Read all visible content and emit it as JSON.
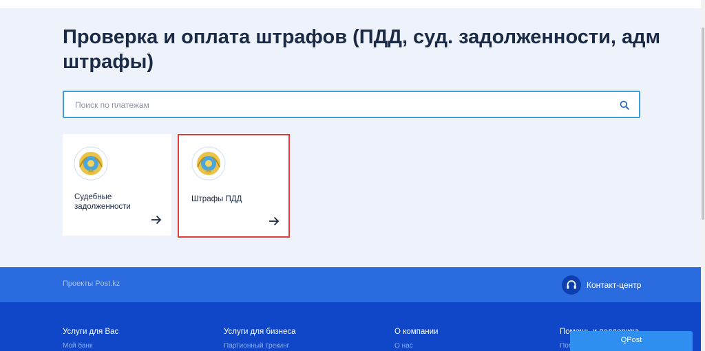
{
  "page": {
    "title": "Проверка и оплата штрафов (ПДД, суд. задолженности, адм штрафы)"
  },
  "search": {
    "placeholder": "Поиск по платежам"
  },
  "cards": [
    {
      "label": "Судебные задолженности",
      "icon": "kazakhstan-emblem-icon",
      "arrow": "arrow-right-icon"
    },
    {
      "label": "Штрафы ПДД",
      "icon": "kazakhstan-emblem-icon",
      "arrow": "arrow-right-icon",
      "highlighted": true
    }
  ],
  "projects_bar": {
    "label": "Проекты Post.kz",
    "contact_label": "Контакт-центр",
    "contact_icon": "headset-icon"
  },
  "footer": {
    "columns": [
      {
        "heading": "Услуги для Вас",
        "first_item": "Мой банк"
      },
      {
        "heading": "Услуги для бизнеса",
        "first_item": "Партионный трекинг"
      },
      {
        "heading": "О компании",
        "first_item": "О нас"
      },
      {
        "heading": "Помощь и поддержка",
        "first_item": "Пом"
      }
    ]
  },
  "qpost": {
    "label": "QPost"
  },
  "colors": {
    "page_bg": "#eef3fb",
    "title": "#1b2a45",
    "search_border": "#3ba0d8",
    "highlight_border": "#e23d3d",
    "projects_bar": "#2a6ce0",
    "footer": "#0f47c8",
    "qpost": "#2e8ff0"
  }
}
